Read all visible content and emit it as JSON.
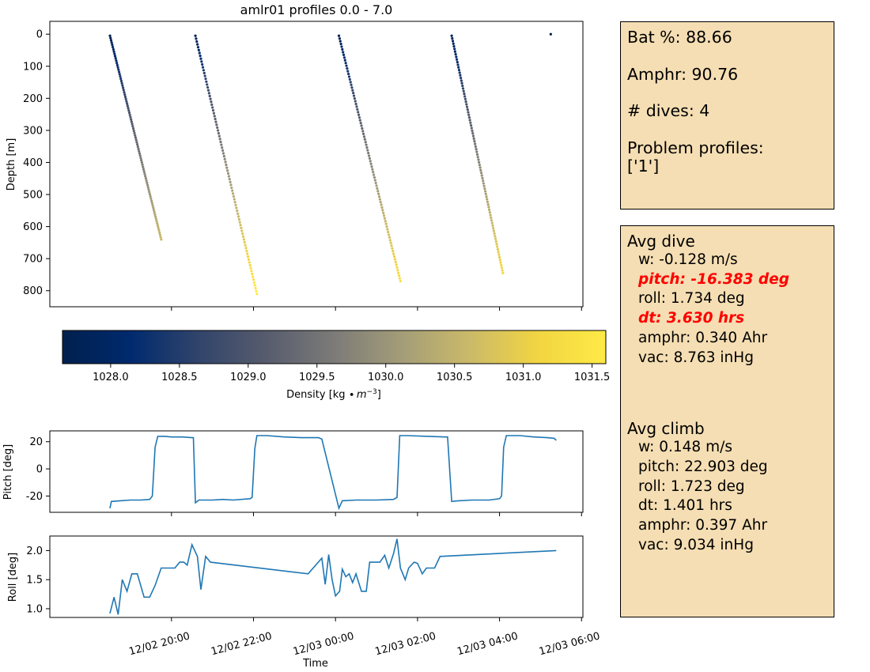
{
  "chart_data": [
    {
      "type": "scatter",
      "title": "amlr01 profiles 0.0 - 7.0",
      "xlabel": "",
      "ylabel": "Depth [m]",
      "ylim": [
        850,
        -40
      ],
      "y_ticks": [
        "0",
        "100",
        "200",
        "300",
        "400",
        "500",
        "600",
        "700",
        "800"
      ],
      "profiles": [
        {
          "x": [
            "12/02 18:30",
            "12/02 19:45"
          ],
          "depth": [
            5,
            640
          ],
          "density": [
            1027.7,
            1030.6
          ]
        },
        {
          "x": [
            "12/02 20:35",
            "12/02 22:05"
          ],
          "depth": [
            5,
            810
          ],
          "density": [
            1027.7,
            1031.6
          ]
        },
        {
          "x": [
            "12/03 00:05",
            "12/03 01:35"
          ],
          "depth": [
            5,
            770
          ],
          "density": [
            1027.7,
            1031.3
          ]
        },
        {
          "x": [
            "12/03 02:50",
            "12/03 04:05"
          ],
          "depth": [
            5,
            745
          ],
          "density": [
            1027.7,
            1031.2
          ]
        },
        {
          "x": [
            "12/03 05:15"
          ],
          "depth": [
            0
          ],
          "density": [
            1027.7
          ]
        }
      ]
    },
    {
      "type": "colorbar",
      "label_main": "Density [kg ∙",
      "label_unit": "m",
      "label_exp": "−3",
      "label_end": "]",
      "range": [
        1027.65,
        1031.6
      ],
      "ticks": [
        1028.0,
        1028.5,
        1029.0,
        1029.5,
        1030.0,
        1030.5,
        1031.0,
        1031.5
      ],
      "tick_labels": [
        "1028.0",
        "1028.5",
        "1029.0",
        "1029.5",
        "1030.0",
        "1030.5",
        "1031.0",
        "1031.5"
      ],
      "colormap": [
        "#00204d",
        "#002a6e",
        "#31446b",
        "#575c6d",
        "#7c7b78",
        "#a49d78",
        "#cbba69",
        "#f1d542",
        "#ffea46"
      ]
    },
    {
      "type": "line",
      "xlabel": "",
      "ylabel": "Pitch [deg]",
      "ylim": [
        -32,
        28
      ],
      "y_ticks": [
        -20,
        0,
        20
      ],
      "color": "#1f77b4",
      "points": [
        [
          "12/02 18:30",
          -29
        ],
        [
          "12/02 18:32",
          -24
        ],
        [
          "12/02 18:45",
          -23.5
        ],
        [
          "12/02 19:00",
          -23
        ],
        [
          "12/02 19:15",
          -23
        ],
        [
          "12/02 19:28",
          -22.5
        ],
        [
          "12/02 19:32",
          -20
        ],
        [
          "12/02 19:36",
          16
        ],
        [
          "12/02 19:40",
          24
        ],
        [
          "12/02 19:50",
          24
        ],
        [
          "12/02 20:00",
          23.5
        ],
        [
          "12/02 20:15",
          23.5
        ],
        [
          "12/02 20:30",
          23
        ],
        [
          "12/02 20:32",
          23
        ],
        [
          "12/02 20:35",
          -25
        ],
        [
          "12/02 20:40",
          -23
        ],
        [
          "12/02 21:00",
          -23
        ],
        [
          "12/02 21:15",
          -22.5
        ],
        [
          "12/02 21:30",
          -23
        ],
        [
          "12/02 21:55",
          -22
        ],
        [
          "12/02 21:58",
          -21
        ],
        [
          "12/02 22:02",
          15
        ],
        [
          "12/02 22:05",
          24.5
        ],
        [
          "12/02 22:20",
          24.5
        ],
        [
          "12/02 22:45",
          23.5
        ],
        [
          "12/02 23:10",
          23
        ],
        [
          "12/02 23:35",
          23
        ],
        [
          "12/02 23:40",
          22
        ],
        [
          "12/03 00:05",
          -29
        ],
        [
          "12/03 00:10",
          -23.5
        ],
        [
          "12/03 00:30",
          -23
        ],
        [
          "12/03 01:00",
          -23
        ],
        [
          "12/03 01:25",
          -22.5
        ],
        [
          "12/03 01:30",
          -21
        ],
        [
          "12/03 01:34",
          24.5
        ],
        [
          "12/03 01:45",
          24.5
        ],
        [
          "12/03 02:15",
          24
        ],
        [
          "12/03 02:40",
          23.5
        ],
        [
          "12/03 02:44",
          23.5
        ],
        [
          "12/03 02:50",
          -24
        ],
        [
          "12/03 03:00",
          -23.5
        ],
        [
          "12/03 03:20",
          -23
        ],
        [
          "12/03 03:45",
          -23
        ],
        [
          "12/03 04:00",
          -22
        ],
        [
          "12/03 04:03",
          -20
        ],
        [
          "12/03 04:06",
          16
        ],
        [
          "12/03 04:10",
          24.5
        ],
        [
          "12/03 04:30",
          24.5
        ],
        [
          "12/03 04:50",
          23.5
        ],
        [
          "12/03 05:10",
          23
        ],
        [
          "12/03 05:20",
          22.5
        ],
        [
          "12/03 05:23",
          21
        ]
      ]
    },
    {
      "type": "line",
      "xlabel": "Time",
      "ylabel": "Roll [deg]",
      "ylim": [
        0.85,
        2.25
      ],
      "y_ticks": [
        "1.0",
        "1.5",
        "2.0"
      ],
      "x_ticks": [
        "12/02 20:00",
        "12/02 22:00",
        "12/03 00:00",
        "12/03 02:00",
        "12/03 04:00",
        "12/03 06:00"
      ],
      "color": "#1f77b4",
      "points": [
        [
          "12/02 18:30",
          0.92
        ],
        [
          "12/02 18:36",
          1.2
        ],
        [
          "12/02 18:42",
          0.9
        ],
        [
          "12/02 18:48",
          1.5
        ],
        [
          "12/02 18:55",
          1.3
        ],
        [
          "12/02 19:02",
          1.6
        ],
        [
          "12/02 19:10",
          1.6
        ],
        [
          "12/02 19:20",
          1.2
        ],
        [
          "12/02 19:28",
          1.2
        ],
        [
          "12/02 19:36",
          1.4
        ],
        [
          "12/02 19:45",
          1.7
        ],
        [
          "12/02 20:00",
          1.7
        ],
        [
          "12/02 20:05",
          1.7
        ],
        [
          "12/02 20:12",
          1.8
        ],
        [
          "12/02 20:18",
          1.8
        ],
        [
          "12/02 20:23",
          1.75
        ],
        [
          "12/02 20:30",
          2.1
        ],
        [
          "12/02 20:38",
          1.9
        ],
        [
          "12/02 20:43",
          1.33
        ],
        [
          "12/02 20:50",
          1.9
        ],
        [
          "12/02 20:57",
          1.8
        ],
        [
          "12/02 23:20",
          1.6
        ],
        [
          "12/02 23:40",
          1.87
        ],
        [
          "12/02 23:45",
          1.42
        ],
        [
          "12/02 23:50",
          1.93
        ],
        [
          "12/02 23:55",
          1.5
        ],
        [
          "12/03 00:00",
          1.22
        ],
        [
          "12/03 00:06",
          1.3
        ],
        [
          "12/03 00:10",
          1.68
        ],
        [
          "12/03 00:15",
          1.55
        ],
        [
          "12/03 00:20",
          1.6
        ],
        [
          "12/03 00:25",
          1.45
        ],
        [
          "12/03 00:30",
          1.6
        ],
        [
          "12/03 00:38",
          1.3
        ],
        [
          "12/03 00:45",
          1.3
        ],
        [
          "12/03 00:50",
          1.8
        ],
        [
          "12/03 01:00",
          1.8
        ],
        [
          "12/03 01:05",
          1.8
        ],
        [
          "12/03 01:12",
          1.92
        ],
        [
          "12/03 01:18",
          1.7
        ],
        [
          "12/03 01:25",
          1.95
        ],
        [
          "12/03 01:30",
          2.2
        ],
        [
          "12/03 01:35",
          1.7
        ],
        [
          "12/03 01:42",
          1.5
        ],
        [
          "12/03 01:47",
          1.7
        ],
        [
          "12/03 01:55",
          1.8
        ],
        [
          "12/03 02:00",
          1.78
        ],
        [
          "12/03 02:07",
          1.6
        ],
        [
          "12/03 02:13",
          1.7
        ],
        [
          "12/03 02:25",
          1.7
        ],
        [
          "12/03 02:33",
          1.9
        ],
        [
          "12/03 05:23",
          2.0
        ]
      ]
    }
  ],
  "stats": {
    "battery": "Bat %: 88.66",
    "amphr": "Amphr: 90.76",
    "dives": "# dives: 4",
    "problem_title": "Problem profiles:",
    "problem_list": "['1']"
  },
  "avg_dive": {
    "title": "Avg dive",
    "items": [
      {
        "text": "w: -0.128 m/s",
        "flag": false
      },
      {
        "text": "pitch: -16.383 deg",
        "flag": true
      },
      {
        "text": "roll: 1.734 deg",
        "flag": false
      },
      {
        "text": "dt: 3.630 hrs",
        "flag": true
      },
      {
        "text": "amphr: 0.340 Ahr",
        "flag": false
      },
      {
        "text": "vac: 8.763 inHg",
        "flag": false
      }
    ]
  },
  "avg_climb": {
    "title": "Avg climb",
    "items": [
      {
        "text": "w: 0.148 m/s",
        "flag": false
      },
      {
        "text": "pitch: 22.903 deg",
        "flag": false
      },
      {
        "text": "roll: 1.723 deg",
        "flag": false
      },
      {
        "text": "dt: 1.401 hrs",
        "flag": false
      },
      {
        "text": "amphr: 0.397 Ahr",
        "flag": false
      },
      {
        "text": "vac: 9.034 inHg",
        "flag": false
      }
    ]
  },
  "colors": {
    "panel_bg": "#f5deb3",
    "flag": "#ff0000",
    "line": "#1f77b4"
  }
}
